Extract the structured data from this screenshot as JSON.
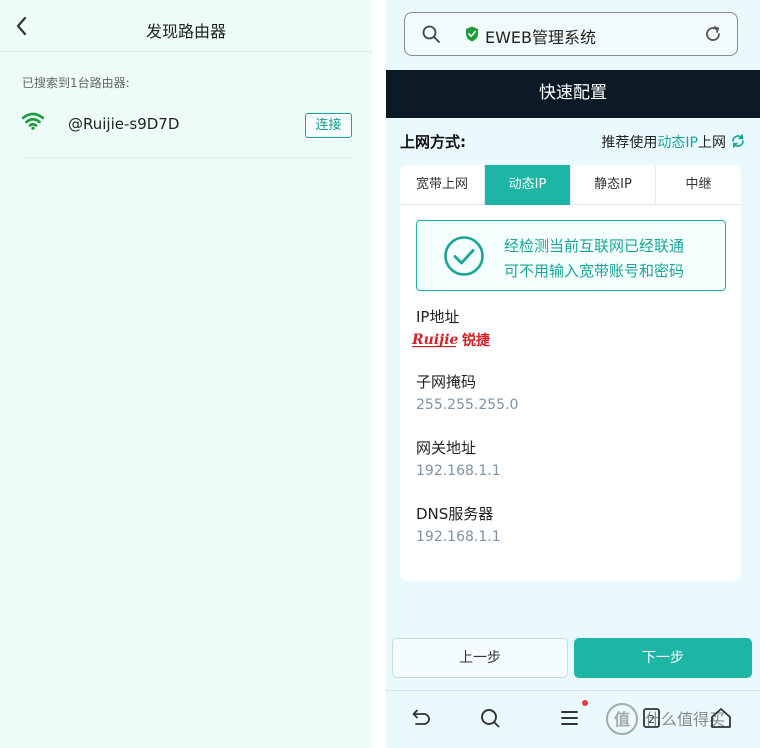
{
  "left": {
    "back_glyph": "‹",
    "title": "发现路由器",
    "found_text": "已搜索到1台路由器:",
    "router": {
      "ssid": "@Ruijie-s9D7D",
      "connect_label": "连接"
    }
  },
  "right": {
    "address_bar": {
      "text": "EWEB管理系统"
    },
    "header_title": "快速配置",
    "method": {
      "label": "上网方式:",
      "recommend_prefix": "推荐使用",
      "recommend_highlight": "动态IP",
      "recommend_suffix": "上网"
    },
    "tabs": [
      {
        "label": "宽带上网",
        "active": false
      },
      {
        "label": "动态IP",
        "active": true
      },
      {
        "label": "静态IP",
        "active": false
      },
      {
        "label": "中继",
        "active": false
      }
    ],
    "status": {
      "line1": "经检测当前互联网已经联通",
      "line2": "可不用输入宽带账号和密码"
    },
    "fields": {
      "ip_label": "IP地址",
      "ip_logo_text": "Ruijie锐捷",
      "mask_label": "子网掩码",
      "mask_value": "255.255.255.0",
      "gateway_label": "网关地址",
      "gateway_value": "192.168.1.1",
      "dns_label": "DNS服务器",
      "dns_value": "192.168.1.1"
    },
    "buttons": {
      "prev": "上一步",
      "next": "下一步"
    },
    "navbar": {
      "tab_count": "2",
      "watermark_text": "什么值得买"
    }
  },
  "colors": {
    "accent": "#1db6a5",
    "header_bar": "#0c1a26",
    "wifi_green": "#1e9c3a",
    "value_gray": "#7b93a6"
  }
}
